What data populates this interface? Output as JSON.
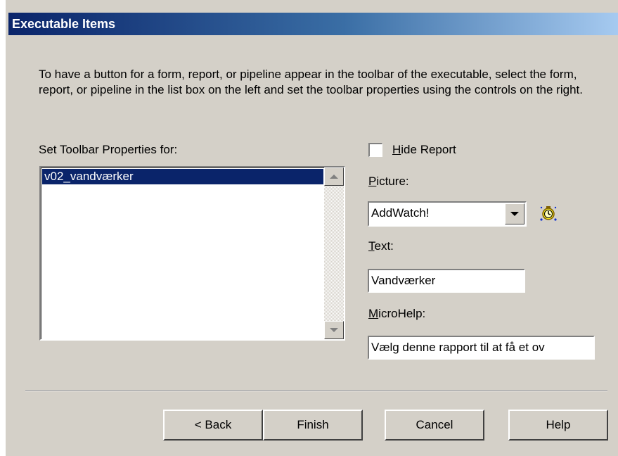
{
  "window": {
    "title": "Executable Items"
  },
  "description": "To have a button for a form, report, or pipeline appear in the toolbar of the executable, select the form, report, or pipeline in the list box on the left and set the toolbar properties using the controls on the right.",
  "list": {
    "label": "Set Toolbar Properties for:",
    "items": [
      "v02_vandværker"
    ],
    "selected_index": 0
  },
  "hide_report": {
    "label_key": "H",
    "label_rest": "ide Report",
    "checked": false
  },
  "picture": {
    "label_key": "P",
    "label_rest": "icture:",
    "value": "AddWatch!",
    "icon": "watch-icon"
  },
  "text": {
    "label_key": "T",
    "label_rest": "ext:",
    "value": "Vandværker"
  },
  "microhelp": {
    "label_key": "M",
    "label_rest": "icroHelp:",
    "value": "Vælg denne rapport til at få et ov"
  },
  "buttons": {
    "back": "< Back",
    "finish": "Finish",
    "cancel": "Cancel",
    "help": "Help"
  }
}
